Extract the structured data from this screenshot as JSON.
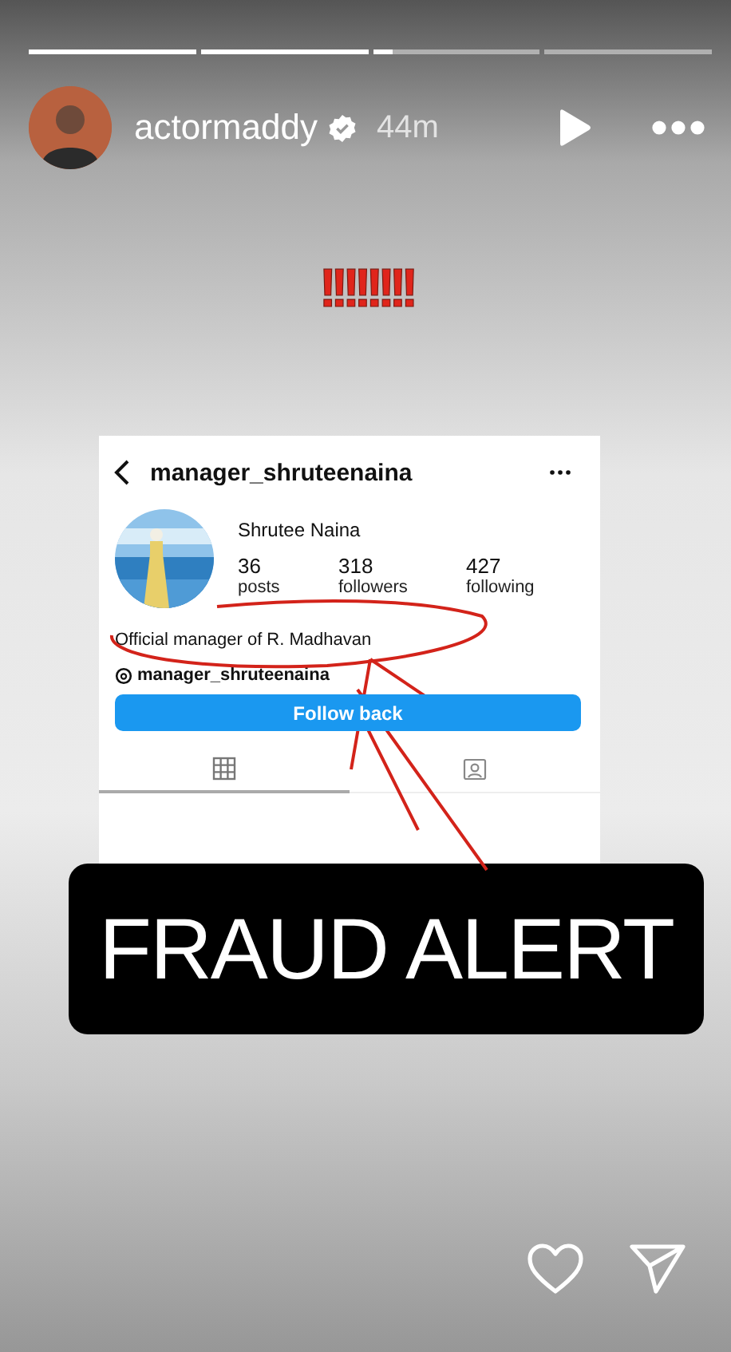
{
  "progress": [
    {
      "level": 1
    },
    {
      "level": 1
    },
    {
      "level": 0.12
    },
    {
      "level": 0
    }
  ],
  "header": {
    "username": "actormaddy",
    "verified": true,
    "time": "44m"
  },
  "caption": "!!!!!!!!",
  "screenshot": {
    "username": "manager_shruteenaina",
    "name": "Shrutee Naina",
    "stats": [
      {
        "value": "36",
        "label": "posts"
      },
      {
        "value": "318",
        "label": "followers"
      },
      {
        "value": "427",
        "label": "following"
      }
    ],
    "bio": "Official manager of R. Madhavan",
    "threads_handle": "manager_shruteenaina",
    "button": "Follow back",
    "tabs": [
      {
        "kind": "grid",
        "selected": true
      },
      {
        "kind": "tagged",
        "selected": false
      }
    ]
  },
  "sticker": "FRAUD ALERT"
}
